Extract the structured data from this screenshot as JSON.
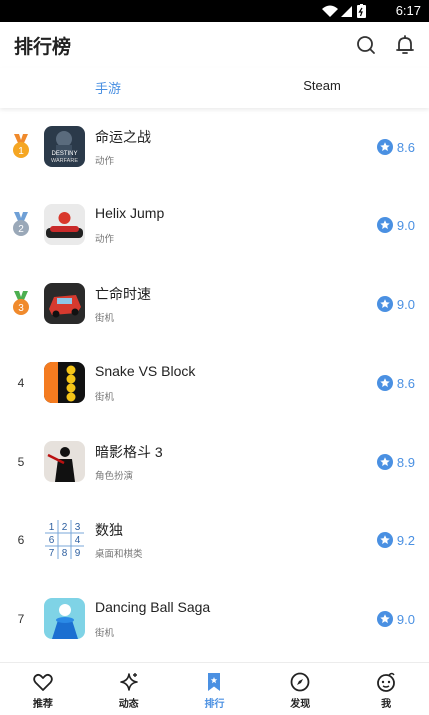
{
  "status_bar": {
    "time": "6:17"
  },
  "app_bar": {
    "title": "排行榜"
  },
  "tabs": [
    {
      "label": "手游",
      "active": true
    },
    {
      "label": "Steam",
      "active": false
    }
  ],
  "games": [
    {
      "rank": "1",
      "name": "命运之战",
      "genre": "动作",
      "score": "8.6",
      "medal": "gold",
      "icon": "destiny-warfare-icon"
    },
    {
      "rank": "2",
      "name": "Helix Jump",
      "genre": "动作",
      "score": "9.0",
      "medal": "silver",
      "icon": "helix-jump-icon"
    },
    {
      "rank": "3",
      "name": "亡命时速",
      "genre": "街机",
      "score": "9.0",
      "medal": "bronze",
      "icon": "racing-car-icon"
    },
    {
      "rank": "4",
      "name": "Snake VS Block",
      "genre": "街机",
      "score": "8.6",
      "medal": "",
      "icon": "snake-vs-block-icon"
    },
    {
      "rank": "5",
      "name": "暗影格斗 3",
      "genre": "角色扮演",
      "score": "8.9",
      "medal": "",
      "icon": "shadow-fight-icon"
    },
    {
      "rank": "6",
      "name": "数独",
      "genre": "桌面和棋类",
      "score": "9.2",
      "medal": "",
      "icon": "sudoku-icon"
    },
    {
      "rank": "7",
      "name": "Dancing Ball Saga",
      "genre": "街机",
      "score": "9.0",
      "medal": "",
      "icon": "dancing-ball-icon"
    }
  ],
  "bottom_nav": [
    {
      "label": "推荐",
      "icon": "heart-icon",
      "active": false
    },
    {
      "label": "动态",
      "icon": "sparkle-icon",
      "active": false
    },
    {
      "label": "排行",
      "icon": "bookmark-icon",
      "active": true
    },
    {
      "label": "发现",
      "icon": "compass-icon",
      "active": false
    },
    {
      "label": "我",
      "icon": "face-icon",
      "active": false
    }
  ],
  "sudoku_digits": [
    "1",
    "2",
    "3",
    "6",
    "",
    "4",
    "7",
    "8",
    "9"
  ],
  "colors": {
    "accent": "#4a90e2",
    "gold": "#f5a623",
    "silver": "#9aa8b8",
    "bronze": "#f08a2c"
  }
}
